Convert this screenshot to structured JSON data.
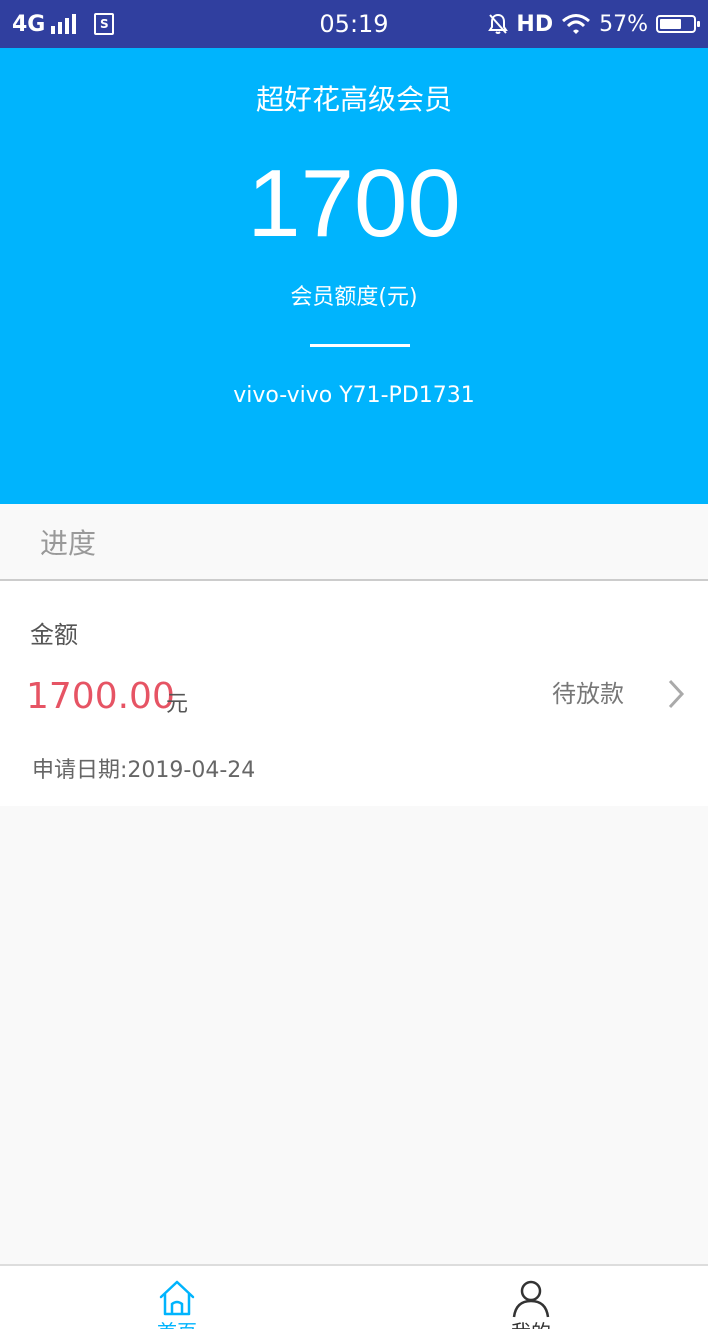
{
  "status_bar": {
    "network": "4G",
    "time": "05:19",
    "hd": "HD",
    "battery": "57%",
    "battery_level": 0.57
  },
  "header": {
    "title": "超好花高级会员",
    "credit_amount": "1700",
    "credit_label": "会员额度(元)",
    "device": "vivo-vivo Y71-PD1731",
    "background_color": "#00b4fd"
  },
  "section": {
    "title": "进度"
  },
  "record": {
    "amount_label": "金额",
    "amount": "1700.00",
    "unit": "元",
    "status": "待放款",
    "date": "申请日期:2019-04-24",
    "amount_color": "#e65464"
  },
  "bottom_nav": {
    "items": [
      {
        "label": "首页",
        "icon": "home-icon",
        "active": true
      },
      {
        "label": "我的",
        "icon": "user-icon",
        "active": false
      }
    ]
  }
}
